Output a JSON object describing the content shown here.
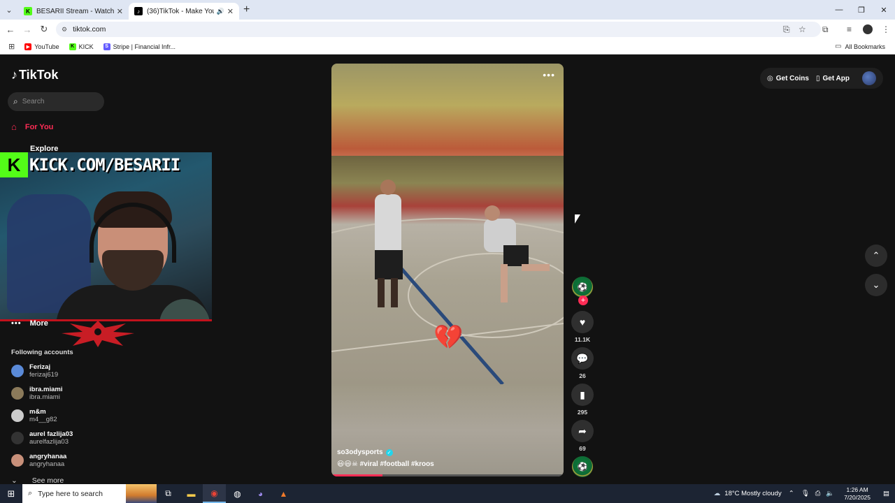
{
  "browser": {
    "tabs": [
      {
        "title": "BESARII Stream - Watch Live on",
        "favicon": "K",
        "favicon_color": "#53fc18",
        "active": false
      },
      {
        "title": "(36)TikTok - Make Your Day",
        "favicon": "♪",
        "favicon_color": "#000000",
        "active": true
      }
    ],
    "url": "tiktok.com",
    "bookmarks": [
      {
        "label": "YouTube",
        "color": "#ff0000",
        "icon": "▶"
      },
      {
        "label": "KICK",
        "color": "#53fc18",
        "icon": "K"
      },
      {
        "label": "Stripe | Financial Infr...",
        "color": "#635bff",
        "icon": "S"
      }
    ],
    "all_bookmarks": "All Bookmarks"
  },
  "tiktok": {
    "logo": "TikTok",
    "search_placeholder": "Search",
    "nav": {
      "for_you": "For You",
      "explore": "Explore",
      "more": "More"
    },
    "following_header": "Following accounts",
    "accounts": [
      {
        "name": "Ferizaj",
        "handle": "ferizaj619",
        "color": "#5a8ad8"
      },
      {
        "name": "ibra.miami",
        "handle": "ibra.miami",
        "color": "#8b7a5a"
      },
      {
        "name": "m&m",
        "handle": "m4__g82",
        "color": "#cccccc"
      },
      {
        "name": "aurel fazlija03",
        "handle": "aurelfazlija03",
        "color": "#333333"
      },
      {
        "name": "angryhanaa",
        "handle": "angryhanaa",
        "color": "#c8907a"
      }
    ],
    "see_more": "See more",
    "top_right": {
      "coins": "Get Coins",
      "app": "Get App"
    },
    "video": {
      "username": "so3odysports",
      "caption": "😃😃☠ #viral #football #kroos",
      "progress": 0.22
    },
    "actions": {
      "likes": "11.1K",
      "comments": "26",
      "saves": "295",
      "shares": "69"
    }
  },
  "overlay": {
    "kick_text": "KICK.COM/BESARII"
  },
  "taskbar": {
    "search_placeholder": "Type here to search",
    "weather": "18°C  Mostly cloudy",
    "time": "1:26 AM",
    "date": "7/20/2025"
  }
}
